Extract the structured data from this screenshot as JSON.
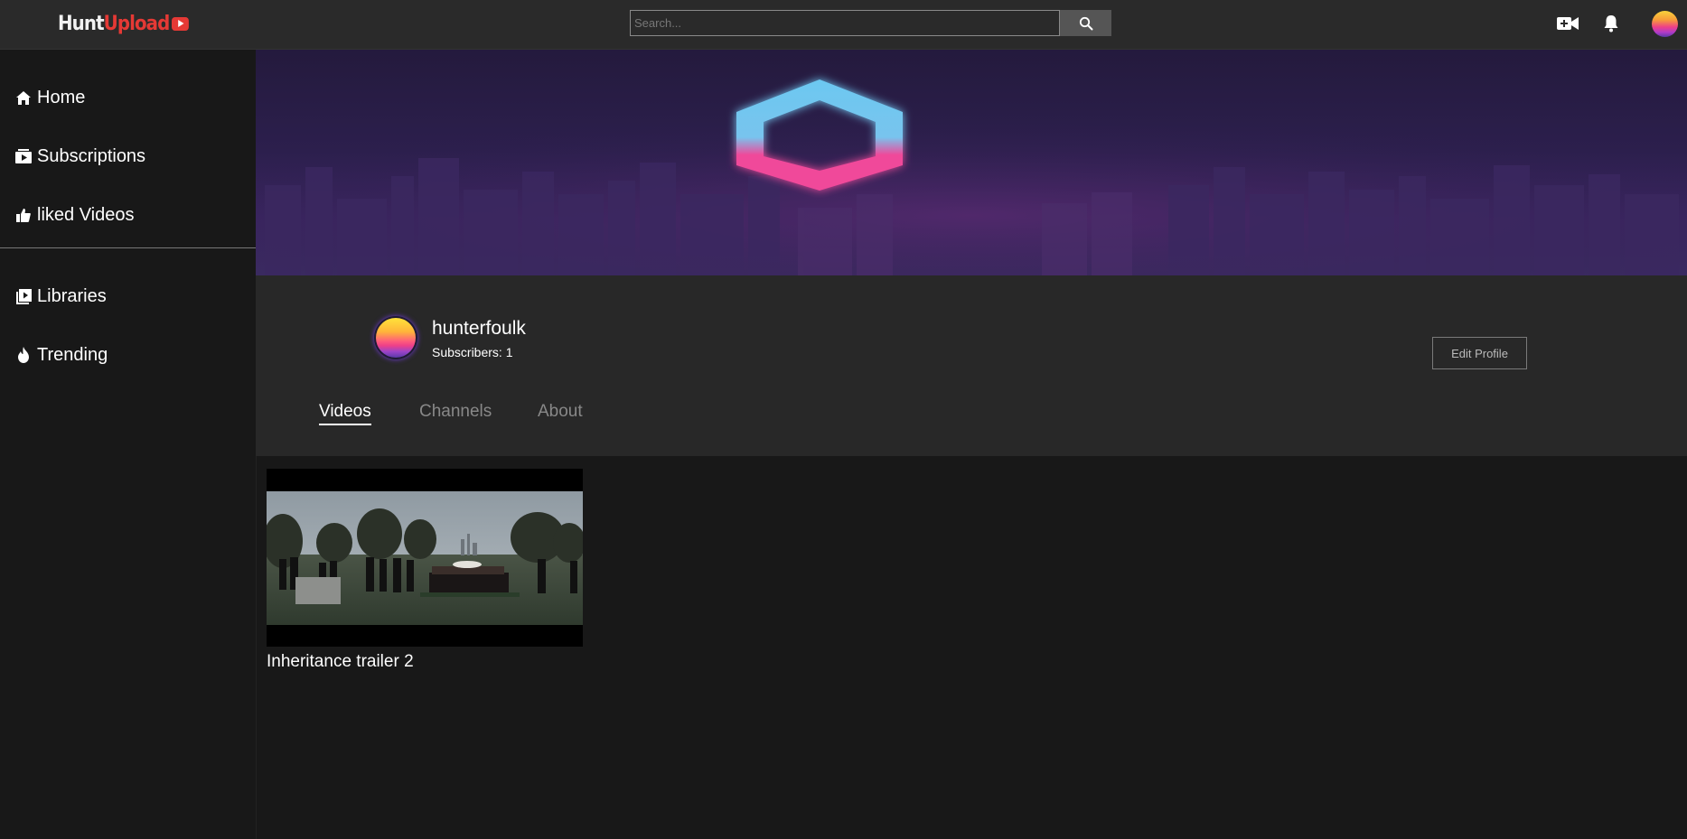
{
  "app": {
    "logo_part1": "Hunt",
    "logo_part2": "Upload",
    "accent": "#e53935"
  },
  "header": {
    "search_placeholder": "Search...",
    "search_icon": "search-icon",
    "upload_icon": "video-plus-icon",
    "notifications_icon": "bell-icon",
    "avatar_icon": "user-avatar"
  },
  "sidebar": {
    "items": [
      {
        "label": "Home",
        "icon": "home-icon"
      },
      {
        "label": "Subscriptions",
        "icon": "subscriptions-icon"
      },
      {
        "label": "liked Videos",
        "icon": "thumbs-up-icon"
      },
      {
        "label": "Libraries",
        "icon": "library-icon"
      },
      {
        "label": "Trending",
        "icon": "fire-icon"
      }
    ]
  },
  "channel": {
    "name": "hunterfoulk",
    "subscribers": "Subscribers: 1",
    "edit_label": "Edit Profile",
    "banner_colors": {
      "hex_top": "#6cc8f0",
      "hex_bottom": "#f0489a",
      "sky": "#2c1f4d"
    }
  },
  "tabs": [
    {
      "label": "Videos",
      "active": true
    },
    {
      "label": "Channels",
      "active": false
    },
    {
      "label": "About",
      "active": false
    }
  ],
  "videos": [
    {
      "title": "Inheritance trailer 2"
    }
  ]
}
